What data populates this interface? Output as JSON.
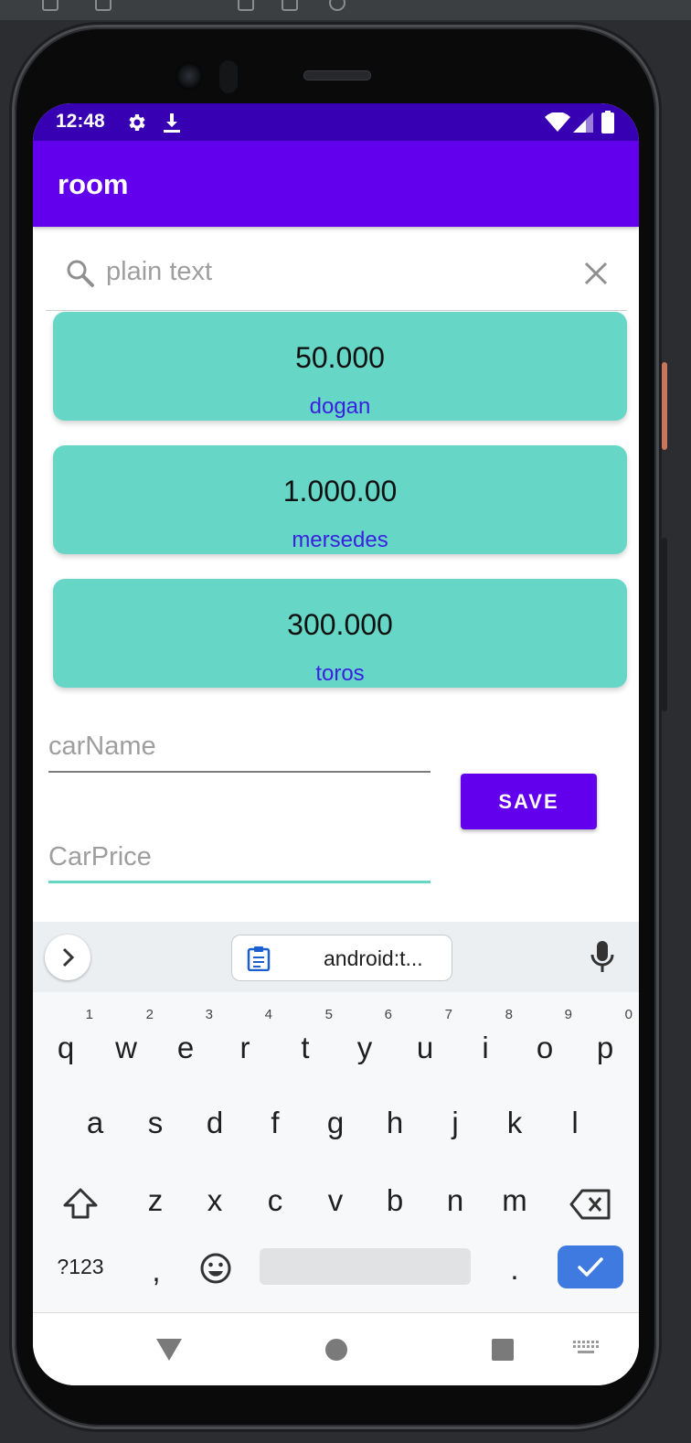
{
  "status_bar": {
    "time": "12:48",
    "left_icons": [
      "gear-icon",
      "download-icon"
    ],
    "right_icons": [
      "wifi-icon",
      "signal-icon",
      "battery-icon"
    ]
  },
  "app_bar": {
    "title": "room"
  },
  "search": {
    "placeholder": "plain text",
    "value": ""
  },
  "cars": [
    {
      "price": "50.000",
      "name": "dogan"
    },
    {
      "price": "1.000.00",
      "name": "mersedes"
    },
    {
      "price": "300.000",
      "name": "toros"
    }
  ],
  "form": {
    "car_name_hint": "carName",
    "car_price_hint": "CarPrice",
    "save_label": "SAVE"
  },
  "keyboard": {
    "clipboard_text": "android:t...",
    "row1": [
      "q",
      "w",
      "e",
      "r",
      "t",
      "y",
      "u",
      "i",
      "o",
      "p"
    ],
    "row1_hints": [
      "1",
      "2",
      "3",
      "4",
      "5",
      "6",
      "7",
      "8",
      "9",
      "0"
    ],
    "row2": [
      "a",
      "s",
      "d",
      "f",
      "g",
      "h",
      "j",
      "k",
      "l"
    ],
    "row3": [
      "z",
      "x",
      "c",
      "v",
      "b",
      "n",
      "m"
    ],
    "symbols_label": "?123",
    "comma_label": ",",
    "period_label": "."
  },
  "colors": {
    "status_bar": "#3700b3",
    "primary": "#6200ee",
    "card": "#66d7c6",
    "card_name_text": "#3a20e0",
    "accent_underline": "#66d7c6",
    "keyboard_enter": "#3f7ae0"
  }
}
